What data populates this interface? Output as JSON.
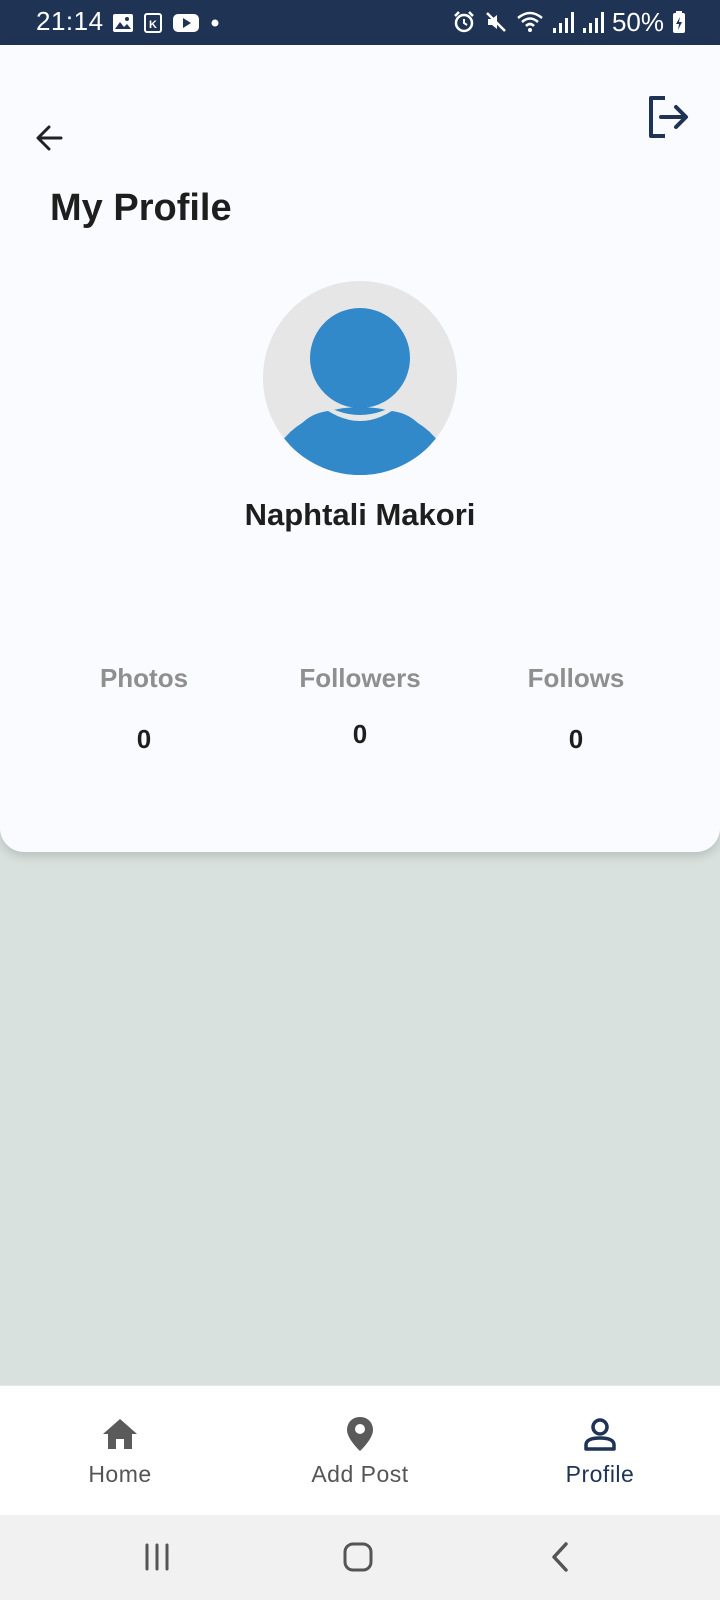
{
  "status_bar": {
    "time": "21:14",
    "battery": "50%",
    "left_icons": [
      "image-icon",
      "k-app-icon",
      "youtube-icon",
      "dot-icon"
    ],
    "right_icons": [
      "alarm-icon",
      "mute-icon",
      "wifi-icon",
      "signal-icon",
      "signal-icon",
      "battery-charging-icon"
    ]
  },
  "header": {
    "title": "My Profile",
    "back_icon": "arrow-left-icon",
    "logout_icon": "logout-icon"
  },
  "profile": {
    "name": "Naphtali Makori",
    "avatar_icon": "default-avatar-icon"
  },
  "stats": [
    {
      "label": "Photos",
      "value": "0"
    },
    {
      "label": "Followers",
      "value": "0"
    },
    {
      "label": "Follows",
      "value": "0"
    }
  ],
  "bottom_nav": [
    {
      "label": "Home",
      "icon": "home-icon"
    },
    {
      "label": "Add Post",
      "icon": "location-pin-icon"
    },
    {
      "label": "Profile",
      "icon": "person-icon",
      "active": true
    }
  ],
  "colors": {
    "status_bar": "#1f3354",
    "card": "#f9fbfe",
    "page_background": "#d8e1dd",
    "avatar_fill": "#3189ca",
    "avatar_background": "#e6e6e6",
    "active_tab": "#1f3354"
  }
}
